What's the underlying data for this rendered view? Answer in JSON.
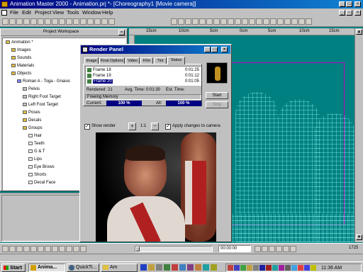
{
  "app": {
    "title": "Animation Master 2000 - Animation.prj *- [Choreography1 [Movie camera]]"
  },
  "menu": [
    "File",
    "Edit",
    "Project",
    "View",
    "Tools",
    "Window",
    "Help"
  ],
  "workspace": {
    "title": "Project Workspace",
    "tree": [
      {
        "label": "Animation *",
        "depth": 0,
        "icon": "folder-icon"
      },
      {
        "label": "Images",
        "depth": 1,
        "icon": "folder-icon"
      },
      {
        "label": "Sounds",
        "depth": 1,
        "icon": "folder-icon"
      },
      {
        "label": "Materials",
        "depth": 1,
        "icon": "folder-icon"
      },
      {
        "label": "Objects",
        "depth": 1,
        "icon": "folder-icon"
      },
      {
        "label": "Roman A - Toga - Gnaius",
        "depth": 2,
        "icon": "model-icon"
      },
      {
        "label": "Pelvis",
        "depth": 3,
        "icon": "bone-icon"
      },
      {
        "label": "Right Foot Target",
        "depth": 3,
        "icon": "bone-icon"
      },
      {
        "label": "Left Foot Target",
        "depth": 3,
        "icon": "bone-icon"
      },
      {
        "label": "Poses",
        "depth": 3,
        "icon": "folder-icon"
      },
      {
        "label": "Decals",
        "depth": 3,
        "icon": "folder-icon"
      },
      {
        "label": "Groups",
        "depth": 3,
        "icon": "folder-icon"
      },
      {
        "label": "Hair",
        "depth": 4,
        "icon": "group-icon"
      },
      {
        "label": "Teeth",
        "depth": 4,
        "icon": "group-icon"
      },
      {
        "label": "G & T",
        "depth": 4,
        "icon": "group-icon"
      },
      {
        "label": "Lips",
        "depth": 4,
        "icon": "group-icon"
      },
      {
        "label": "Eye Brows",
        "depth": 4,
        "icon": "group-icon"
      },
      {
        "label": "Shorts",
        "depth": 4,
        "icon": "group-icon"
      },
      {
        "label": "Decal Face",
        "depth": 4,
        "icon": "group-icon"
      }
    ]
  },
  "render_panel": {
    "title": "Render Panel",
    "tabs": [
      "Image",
      "Final Options",
      "Video",
      "Film",
      "Tint",
      "Status"
    ],
    "active_tab": "Status",
    "frames": [
      {
        "name": "Frame 18",
        "time": "0:01:25"
      },
      {
        "name": "Frame 19",
        "time": "0:01:12"
      },
      {
        "name": "Frame 20",
        "time": "0:01:05"
      }
    ],
    "start_label": "Start",
    "stop_label": "Stop",
    "rendered_label": "Rendered:",
    "rendered_value": "21",
    "avg_time_label": "Avg. Time:",
    "avg_time_value": "0:01:30",
    "est_time_label": "Est. Time:",
    "est_time_value": "",
    "status_text": "Freeing Memory",
    "current_label": "Current:",
    "current_value": "100 %",
    "all_label": "All:",
    "all_value": "100 %",
    "show_render_label": "Show render",
    "zoom_label": "1:1",
    "apply_changes_label": "Apply changes to camera"
  },
  "ruler": {
    "labels": [
      "15cm",
      "10cm",
      "5cm",
      "0cm",
      "5cm",
      "10cm",
      "15cm"
    ]
  },
  "timeline": {
    "time_value": "00:00:00",
    "frame_value": "1725"
  },
  "taskbar": {
    "start_label": "Start",
    "buttons": [
      "Anima...",
      "QuickTi...",
      "Am"
    ],
    "clock": "11:36 AM"
  },
  "colors": {
    "teal": "#008080",
    "title_blue": "#000080",
    "wireframe": "#78e6e6",
    "magenta": "#c000c0"
  }
}
